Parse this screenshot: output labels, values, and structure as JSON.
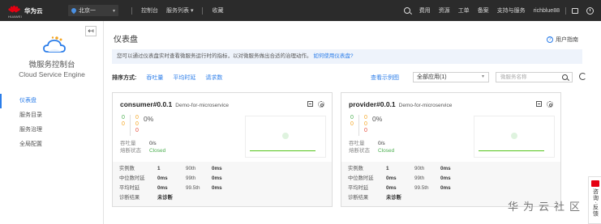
{
  "topbar": {
    "brand_name": "华为云",
    "logo_text": "HUAWEI",
    "region": "北京一",
    "nav": [
      "控制台",
      "服务列表 ▾",
      "收藏"
    ],
    "right_links": [
      "费用",
      "资源",
      "工单",
      "备案",
      "支持与服务"
    ],
    "username": "richblue88"
  },
  "sidebar": {
    "collapse_label": "↤",
    "title": "微服务控制台",
    "subtitle": "Cloud Service Engine",
    "items": [
      {
        "label": "仪表盘",
        "active": true
      },
      {
        "label": "服务目录",
        "active": false
      },
      {
        "label": "服务治理",
        "active": false
      },
      {
        "label": "全局配置",
        "active": false
      }
    ]
  },
  "main": {
    "title": "仪表盘",
    "help": "用户指南",
    "info_text": "您可以通过仪表盘实时查看微服务运行时的指标，以对微服务做出合适的治理动作。",
    "info_link": "如何使用仪表盘?",
    "sort_label": "排序方式:",
    "sort_options": [
      "吞吐量",
      "平均时延",
      "请求数"
    ],
    "view_link": "查看示例图",
    "app_select": "全部应用(1)",
    "search_placeholder": "微服务名称"
  },
  "cards": [
    {
      "name": "consumer#0.0.1",
      "app": "Demo-for-microservice",
      "counts": {
        "green": "0",
        "orange1": "0",
        "orange2": "0",
        "orange3": "0",
        "red": "0"
      },
      "percent": "0%",
      "throughput_label": "吞吐量",
      "throughput": "0/s",
      "breaker_label": "熔断状态",
      "breaker": "Closed",
      "stats": [
        {
          "k": "实例数",
          "v": "1",
          "pk": "90th",
          "pv": "0ms"
        },
        {
          "k": "中位数时延",
          "v": "0ms",
          "pk": "99th",
          "pv": "0ms"
        },
        {
          "k": "平均时延",
          "v": "0ms",
          "pk": "99.5th",
          "pv": "0ms"
        },
        {
          "k": "诊断结果",
          "v": "未诊断",
          "pk": "",
          "pv": ""
        }
      ]
    },
    {
      "name": "provider#0.0.1",
      "app": "Demo-for-microservice",
      "counts": {
        "green": "0",
        "orange1": "0",
        "orange2": "0",
        "orange3": "0",
        "red": "0"
      },
      "percent": "0%",
      "throughput_label": "吞吐量",
      "throughput": "0/s",
      "breaker_label": "熔断状态",
      "breaker": "Closed",
      "stats": [
        {
          "k": "实例数",
          "v": "1",
          "pk": "90th",
          "pv": "0ms"
        },
        {
          "k": "中位数时延",
          "v": "0ms",
          "pk": "99th",
          "pv": "0ms"
        },
        {
          "k": "平均时延",
          "v": "0ms",
          "pk": "99.5th",
          "pv": "0ms"
        },
        {
          "k": "诊断结果",
          "v": "未诊断",
          "pk": "",
          "pv": ""
        }
      ]
    }
  ],
  "float_side": {
    "label": "咨询·反馈"
  },
  "watermark": "华为云社区",
  "colors": {
    "accent": "#2b7de9",
    "topbar": "#2b2b2b",
    "closed": "#4caf50",
    "brand_red": "#e60012"
  }
}
